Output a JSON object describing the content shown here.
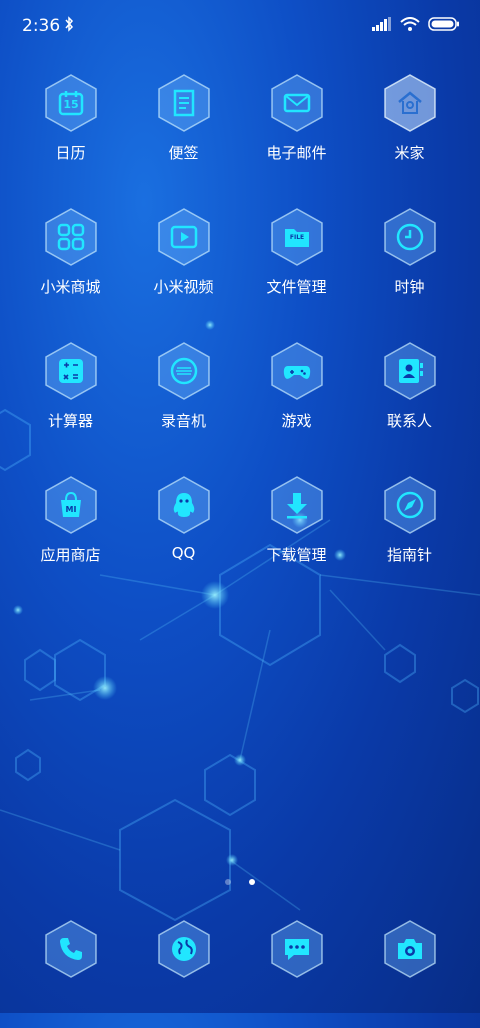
{
  "status": {
    "time": "2:36",
    "bluetooth_icon": "bluetooth-icon",
    "signal_icon": "signal-icon",
    "wifi_icon": "wifi-icon",
    "battery_icon": "battery-icon"
  },
  "apps": [
    {
      "label": "日历",
      "icon": "calendar-icon",
      "date": "15"
    },
    {
      "label": "便签",
      "icon": "notes-icon"
    },
    {
      "label": "电子邮件",
      "icon": "mail-icon"
    },
    {
      "label": "米家",
      "icon": "mijia-icon"
    },
    {
      "label": "小米商城",
      "icon": "store-icon"
    },
    {
      "label": "小米视频",
      "icon": "video-icon"
    },
    {
      "label": "文件管理",
      "icon": "file-manager-icon",
      "badge": "FILE"
    },
    {
      "label": "时钟",
      "icon": "clock-icon"
    },
    {
      "label": "计算器",
      "icon": "calculator-icon"
    },
    {
      "label": "录音机",
      "icon": "recorder-icon"
    },
    {
      "label": "游戏",
      "icon": "gamepad-icon"
    },
    {
      "label": "联系人",
      "icon": "contacts-icon"
    },
    {
      "label": "应用商店",
      "icon": "app-store-icon",
      "badge": "MI"
    },
    {
      "label": "QQ",
      "icon": "qq-icon"
    },
    {
      "label": "下载管理",
      "icon": "download-icon"
    },
    {
      "label": "指南针",
      "icon": "compass-icon"
    }
  ],
  "dock": [
    {
      "icon": "phone-icon"
    },
    {
      "icon": "browser-globe-icon"
    },
    {
      "icon": "messages-icon"
    },
    {
      "icon": "camera-icon"
    }
  ],
  "page_indicator": {
    "count": 2,
    "active": 2
  },
  "colors": {
    "accent": "#21e6ff",
    "background": "#0e4fc6"
  }
}
